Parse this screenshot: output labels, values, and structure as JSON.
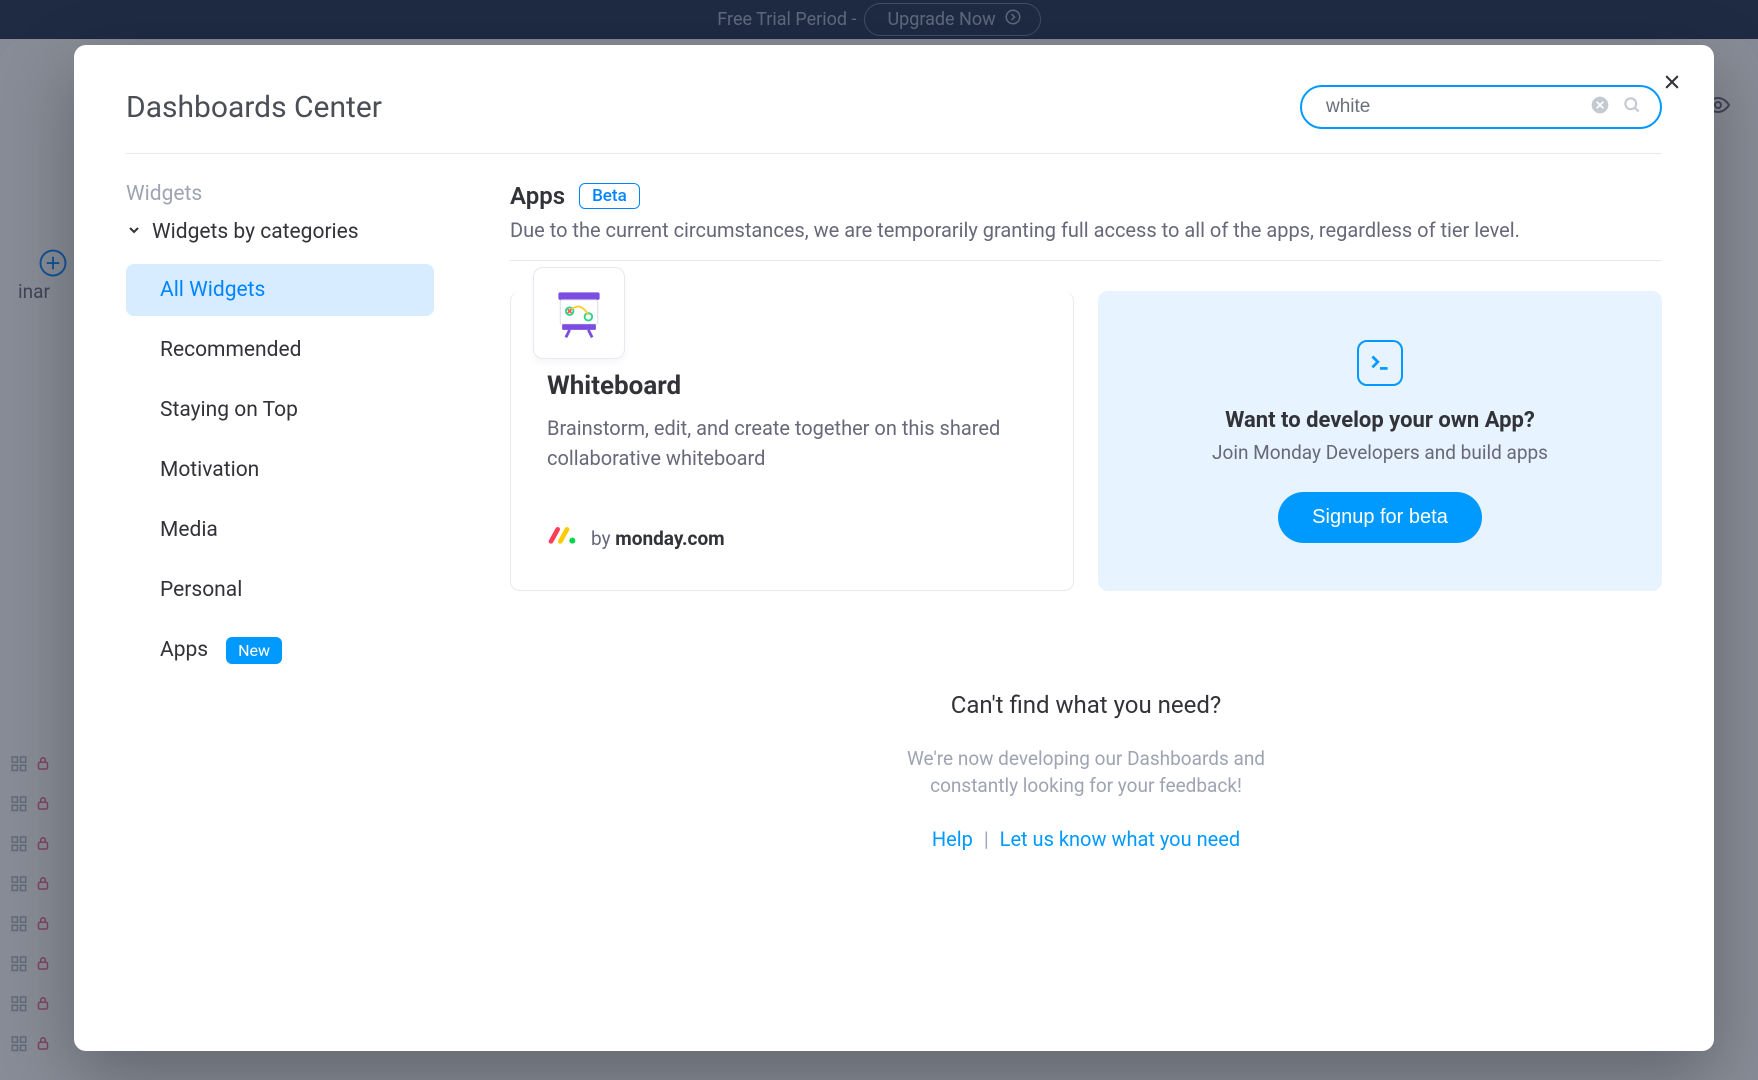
{
  "background": {
    "trial_text": "Free Trial Period -",
    "upgrade_label": "Upgrade Now",
    "plus_label": "inar"
  },
  "modal": {
    "title": "Dashboards Center",
    "search_value": "white"
  },
  "sidebar": {
    "heading": "Widgets",
    "subheading": "Widgets by categories",
    "items": [
      {
        "label": "All Widgets",
        "active": true
      },
      {
        "label": "Recommended"
      },
      {
        "label": "Staying on Top"
      },
      {
        "label": "Motivation"
      },
      {
        "label": "Media"
      },
      {
        "label": "Personal"
      },
      {
        "label": "Apps",
        "badge": "New"
      }
    ]
  },
  "section": {
    "title": "Apps",
    "badge": "Beta",
    "subtitle": "Due to the current circumstances, we are temporarily granting full access to all of the apps, regardless of tier level."
  },
  "app_card": {
    "title": "Whiteboard",
    "description": "Brainstorm, edit, and create together on this shared collaborative whiteboard",
    "by_prefix": "by ",
    "by_brand": "monday.com"
  },
  "dev_card": {
    "title": "Want to develop your own App?",
    "subtitle": "Join Monday Developers and build apps",
    "cta": "Signup for beta"
  },
  "footer": {
    "heading": "Can't find what you need?",
    "line1": "We're now developing our Dashboards and",
    "line2": "constantly looking for your feedback!",
    "help": "Help",
    "feedback": "Let us know what you need",
    "sep": "|"
  }
}
